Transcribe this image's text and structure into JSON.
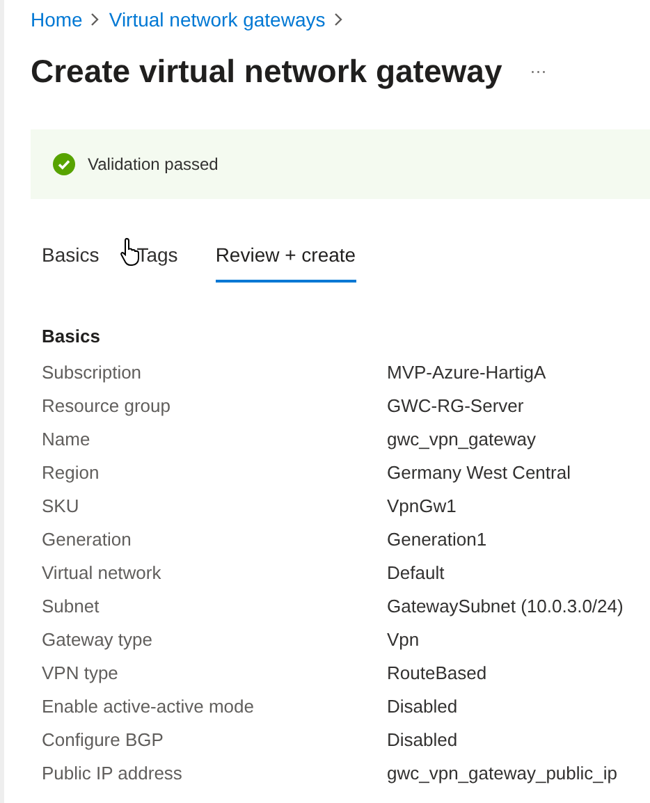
{
  "breadcrumb": [
    "Home",
    "Virtual network gateways"
  ],
  "title": "Create virtual network gateway",
  "more": "···",
  "banner": {
    "kind": "success",
    "text": "Validation passed"
  },
  "tabs": [
    {
      "label": "Basics",
      "selected": false
    },
    {
      "label": "Tags",
      "selected": false
    },
    {
      "label": "Review + create",
      "selected": true
    }
  ],
  "section": {
    "title": "Basics",
    "rows": [
      {
        "label": "Subscription",
        "value": "MVP-Azure-HartigA"
      },
      {
        "label": "Resource group",
        "value": "GWC-RG-Server"
      },
      {
        "label": "Name",
        "value": "gwc_vpn_gateway"
      },
      {
        "label": "Region",
        "value": "Germany West Central"
      },
      {
        "label": "SKU",
        "value": "VpnGw1"
      },
      {
        "label": "Generation",
        "value": "Generation1"
      },
      {
        "label": "Virtual network",
        "value": "Default"
      },
      {
        "label": "Subnet",
        "value": "GatewaySubnet (10.0.3.0/24)"
      },
      {
        "label": "Gateway type",
        "value": "Vpn"
      },
      {
        "label": "VPN type",
        "value": "RouteBased"
      },
      {
        "label": "Enable active-active mode",
        "value": "Disabled"
      },
      {
        "label": "Configure BGP",
        "value": "Disabled"
      },
      {
        "label": "Public IP address",
        "value": "gwc_vpn_gateway_public_ip"
      }
    ]
  }
}
